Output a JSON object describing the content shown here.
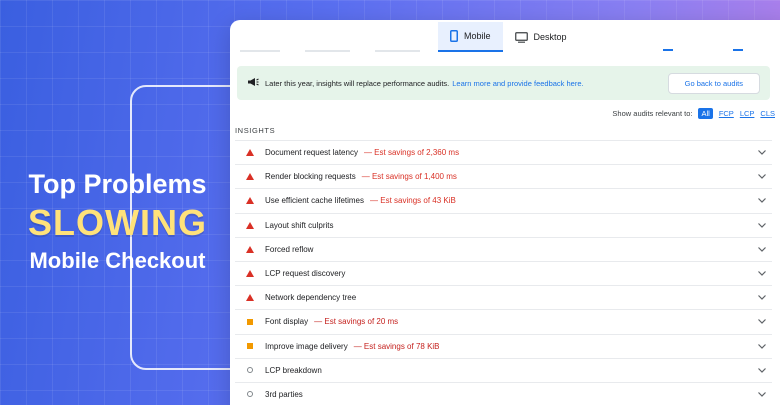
{
  "headline": {
    "line1": "Top Problems",
    "line2": "SLOWING",
    "line3": "Mobile Checkout"
  },
  "tabs": [
    {
      "label": "Mobile",
      "active": true,
      "icon": "mobile-icon"
    },
    {
      "label": "Desktop",
      "active": false,
      "icon": "desktop-icon"
    }
  ],
  "notice": {
    "text": "Later this year, insights will replace performance audits.",
    "link": "Learn more and provide feedback here.",
    "button": "Go back to audits",
    "icon": "megaphone-icon"
  },
  "filters": {
    "label": "Show audits relevant to:",
    "chips": [
      "All",
      "FCP",
      "LCP",
      "CLS"
    ],
    "active": "All"
  },
  "section_title": "INSIGHTS",
  "insights": [
    {
      "label": "Document request latency",
      "savings": "— Est savings of 2,360 ms",
      "severity": "fail"
    },
    {
      "label": "Render blocking requests",
      "savings": "— Est savings of 1,400 ms",
      "severity": "fail"
    },
    {
      "label": "Use efficient cache lifetimes",
      "savings": "— Est savings of 43 KiB",
      "severity": "fail"
    },
    {
      "label": "Layout shift culprits",
      "savings": "",
      "severity": "fail"
    },
    {
      "label": "Forced reflow",
      "savings": "",
      "severity": "fail"
    },
    {
      "label": "LCP request discovery",
      "savings": "",
      "severity": "fail"
    },
    {
      "label": "Network dependency tree",
      "savings": "",
      "severity": "fail"
    },
    {
      "label": "Font display",
      "savings": "— Est savings of 20 ms",
      "severity": "average"
    },
    {
      "label": "Improve image delivery",
      "savings": "— Est savings of 78 KiB",
      "severity": "average"
    },
    {
      "label": "LCP breakdown",
      "savings": "",
      "severity": "info"
    },
    {
      "label": "3rd parties",
      "savings": "",
      "severity": "info"
    }
  ],
  "colors": {
    "fail": "#d93025",
    "average": "#f29900",
    "accent": "#1a73e8"
  }
}
